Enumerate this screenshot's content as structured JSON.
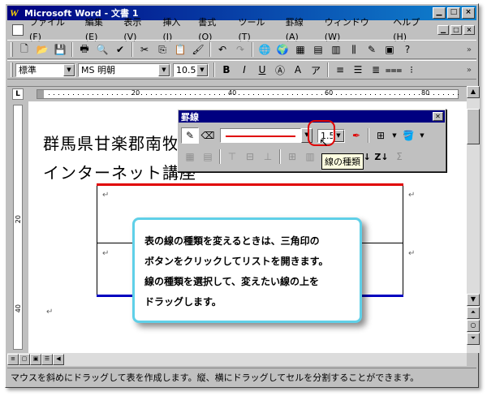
{
  "window": {
    "title": "Microsoft Word - 文書 1",
    "app_icon_letter": "W",
    "minimize": "▁",
    "maximize": "□",
    "close": "×"
  },
  "menubar": {
    "items": [
      {
        "label": "ファイル(F)"
      },
      {
        "label": "編集(E)"
      },
      {
        "label": "表示(V)"
      },
      {
        "label": "挿入(I)"
      },
      {
        "label": "書式(O)"
      },
      {
        "label": "ツール(T)"
      },
      {
        "label": "罫線(A)"
      },
      {
        "label": "ウィンドウ(W)"
      },
      {
        "label": "ヘルプ(H)"
      }
    ]
  },
  "formatting": {
    "style": "標準",
    "font": "MS 明朝",
    "size": "10.5"
  },
  "ruler": {
    "h_marks": [
      "20",
      "40",
      "60",
      "80"
    ],
    "v_marks": [
      "20",
      "40"
    ]
  },
  "document": {
    "line1": "群馬県甘楽郡南牧",
    "line2": "インターネット講座",
    "return_mark": "↵"
  },
  "tables_borders_toolbar": {
    "title": "罫線",
    "line_weight": "1.5",
    "line_style_color": "#e00000",
    "tooltip": "線の種類"
  },
  "callout": {
    "lines": [
      "表の線の種類を変えるときは、三角印の",
      "ボタンをクリックしてリストを開きます。",
      "線の種類を選択して、変えたい線の上を",
      "ドラッグします。"
    ],
    "border_color": "#5fd0e8"
  },
  "statusbar": {
    "text": "マウスを斜めにドラッグして表を作成します。縦、横にドラッグしてセルを分割することができます。"
  },
  "colors": {
    "title_gradient_start": "#000080",
    "title_gradient_end": "#1084d0",
    "table_top_border": "#e00000",
    "table_bottom_border": "#0000c0"
  }
}
